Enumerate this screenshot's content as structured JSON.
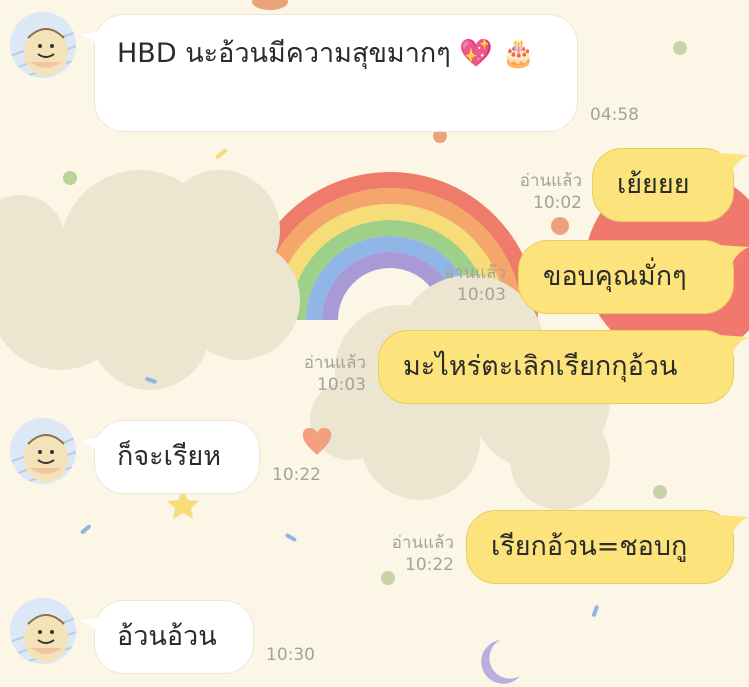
{
  "chat": {
    "messages": [
      {
        "side": "in",
        "text": "HBD นะอ้วนมีความสุขมากๆ 💖 🎂",
        "time": "04:58"
      },
      {
        "side": "out",
        "text": "เย้ยยย",
        "read": "อ่านแล้ว",
        "time": "10:02"
      },
      {
        "side": "out",
        "text": "ขอบคุณมั่กๆ",
        "read": "อ่านแล้ว",
        "time": "10:03"
      },
      {
        "side": "out",
        "text": "มะไหร่ตะเลิกเรียกกุอ้วน",
        "read": "อ่านแล้ว",
        "time": "10:03"
      },
      {
        "side": "in",
        "text": "ก็จะเรียห",
        "time": "10:22"
      },
      {
        "side": "out",
        "text": "เรียกอ้วน=ชอบกู",
        "read": "อ่านแล้ว",
        "time": "10:22"
      },
      {
        "side": "in",
        "text": "อ้วนอ้วน",
        "time": "10:30"
      }
    ]
  },
  "colors": {
    "outgoing_bubble": "#fde37b",
    "incoming_bubble": "#ffffff",
    "background": "#fbf6e6"
  },
  "icons": {
    "contact_avatar": "avatar-icon",
    "emoji_heart": "sparkling-heart",
    "emoji_cake": "birthday-cake"
  }
}
